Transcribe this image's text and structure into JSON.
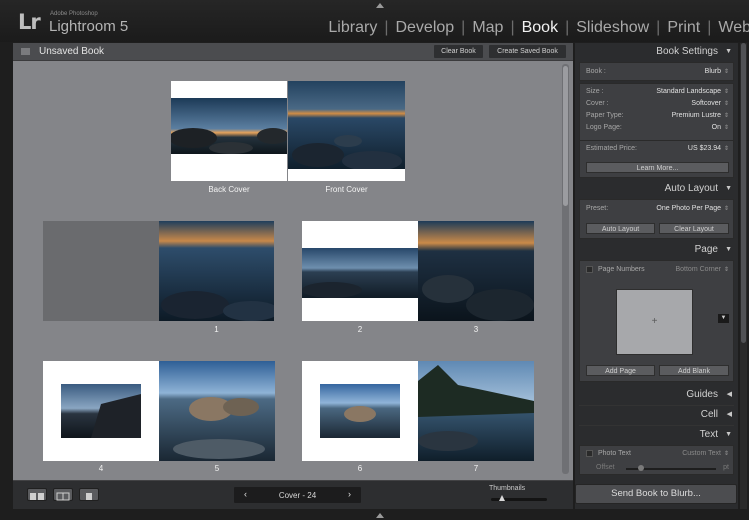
{
  "app": {
    "brand_small": "Adobe Photoshop",
    "brand_main": "Lightroom 5",
    "logo": "Lr",
    "modules": [
      "Library",
      "Develop",
      "Map",
      "Book",
      "Slideshow",
      "Print",
      "Web"
    ],
    "active_module": "Book",
    "module_separator": "|"
  },
  "main": {
    "title": "Unsaved Book",
    "clear_book": "Clear Book",
    "create_saved_book": "Create Saved Book",
    "covers": {
      "back_label": "Back Cover",
      "front_label": "Front Cover"
    },
    "page_numbers": [
      "1",
      "2",
      "3",
      "4",
      "5",
      "6",
      "7"
    ]
  },
  "bottom": {
    "nav_label": "Cover - 24",
    "prev_arrow": "‹",
    "next_arrow": "›",
    "thumbnails_label": "Thumbnails",
    "thumbnail_size_fraction": 0.2,
    "view_buttons": [
      "multi-page-view-icon",
      "spread-view-icon",
      "single-page-view-icon"
    ]
  },
  "right": {
    "book_settings": {
      "title": "Book Settings",
      "book_label": "Book :",
      "book_value": "Blurb",
      "size_label": "Size :",
      "size_value": "Standard Landscape",
      "cover_label": "Cover :",
      "cover_value": "Softcover",
      "paper_label": "Paper Type:",
      "paper_value": "Premium Lustre",
      "logo_label": "Logo Page:",
      "logo_value": "On",
      "price_label": "Estimated Price:",
      "price_value": "US $23.94",
      "learn_more": "Learn More..."
    },
    "auto_layout": {
      "title": "Auto Layout",
      "preset_label": "Preset:",
      "preset_value": "One Photo Per Page",
      "auto_layout_btn": "Auto Layout",
      "clear_layout_btn": "Clear Layout"
    },
    "page": {
      "title": "Page",
      "page_numbers_label": "Page Numbers",
      "page_numbers_position": "Bottom Corner",
      "plus": "+",
      "add_page": "Add Page",
      "add_blank": "Add Blank"
    },
    "guides": {
      "title": "Guides"
    },
    "cell": {
      "title": "Cell"
    },
    "text": {
      "title": "Text",
      "photo_text_label": "Photo Text",
      "photo_text_value": "Custom Text",
      "offset_label": "Offset",
      "offset_value": "pt"
    },
    "send_button": "Send Book to Blurb..."
  },
  "colors": {
    "background": "#1e1e1e",
    "canvas": "#848589",
    "panel": "#2b2c2e",
    "active_module_text": "#f2f2f2"
  }
}
